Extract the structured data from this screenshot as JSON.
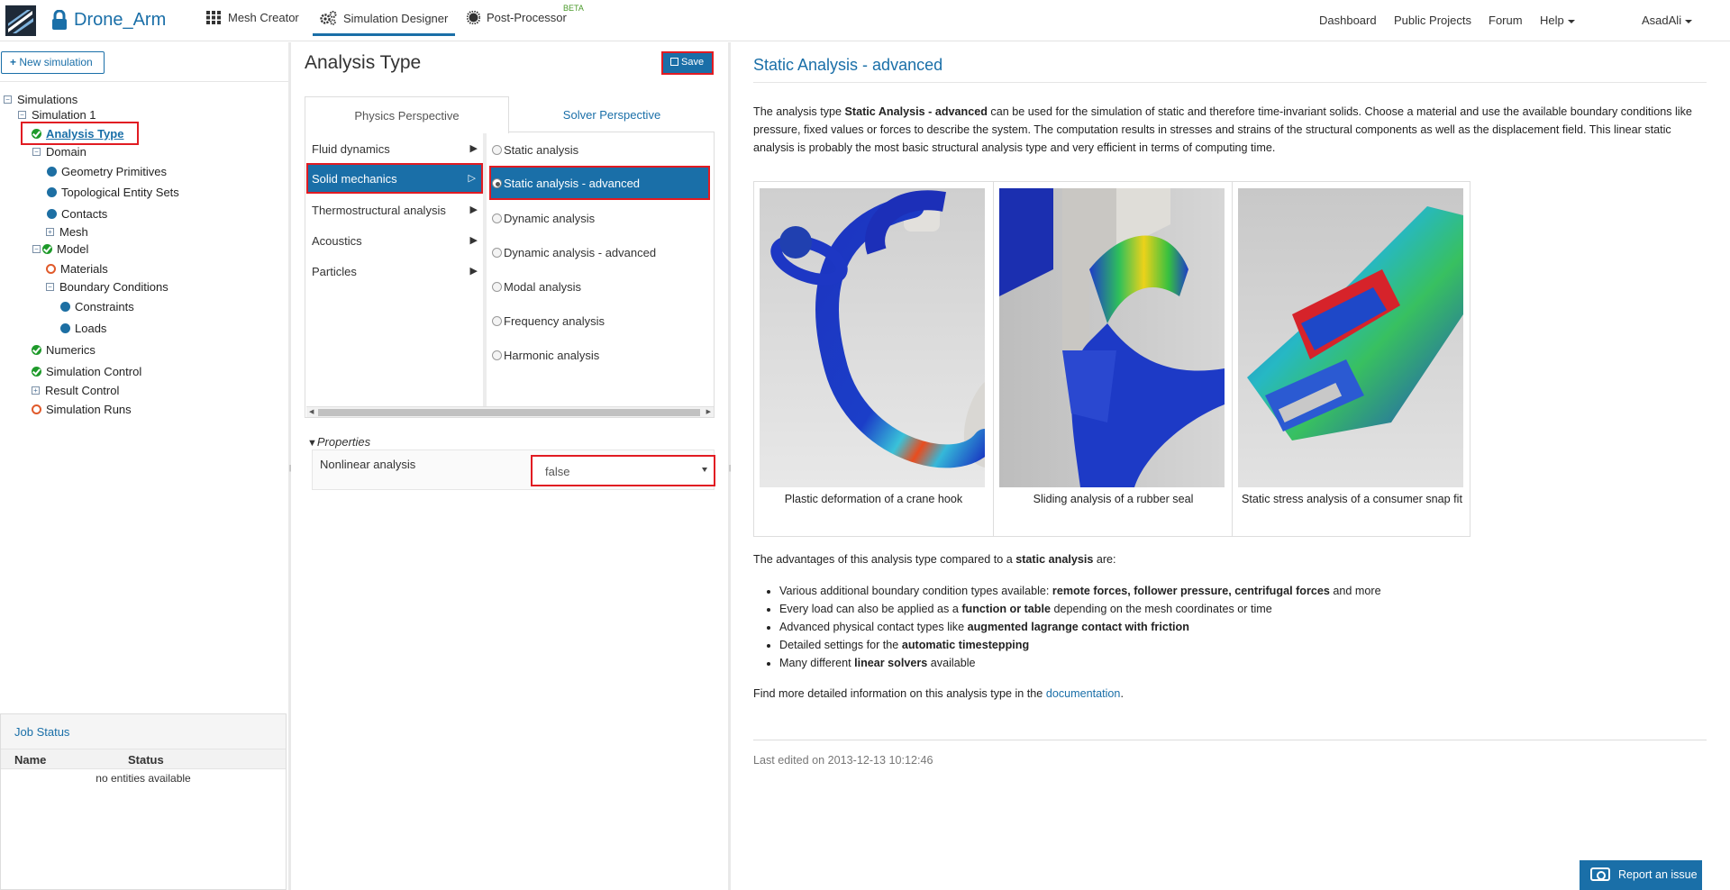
{
  "topbar": {
    "project_name": "Drone_Arm",
    "tabs": [
      {
        "label": "Mesh Creator",
        "icon": "grid-icon"
      },
      {
        "label": "Simulation Designer",
        "icon": "gears-icon",
        "active": true
      },
      {
        "label": "Post-Processor",
        "icon": "gear-burst-icon",
        "badge": "BETA"
      }
    ],
    "right_links": [
      "Dashboard",
      "Public Projects",
      "Forum",
      "Help"
    ],
    "user": "AsadAli"
  },
  "sidebar": {
    "new_simulation_label": "New simulation",
    "tree": {
      "root": "Simulations",
      "simulation": "Simulation 1",
      "analysis_type": "Analysis Type",
      "domain": "Domain",
      "domain_children": [
        "Geometry Primitives",
        "Topological Entity Sets",
        "Contacts",
        "Mesh"
      ],
      "model": "Model",
      "materials": "Materials",
      "boundary_conditions": "Boundary Conditions",
      "bc_children": [
        "Constraints",
        "Loads"
      ],
      "numerics": "Numerics",
      "simulation_control": "Simulation Control",
      "result_control": "Result Control",
      "simulation_runs": "Simulation Runs"
    },
    "job_status": {
      "title": "Job Status",
      "columns": [
        "Name",
        "Status"
      ],
      "empty": "no entities available"
    }
  },
  "middle": {
    "title": "Analysis Type",
    "save_label": "Save",
    "tabs": [
      "Physics Perspective",
      "Solver Perspective"
    ],
    "categories": [
      "Fluid dynamics",
      "Solid mechanics",
      "Thermostructural analysis",
      "Acoustics",
      "Particles"
    ],
    "selected_category": "Solid mechanics",
    "options": [
      "Static analysis",
      "Static analysis - advanced",
      "Dynamic analysis",
      "Dynamic analysis - advanced",
      "Modal analysis",
      "Frequency analysis",
      "Harmonic analysis"
    ],
    "selected_option": "Static analysis - advanced",
    "properties": {
      "heading": "Properties",
      "rows": [
        {
          "label": "Nonlinear analysis",
          "value": "false"
        }
      ]
    }
  },
  "content": {
    "title": "Static Analysis - advanced",
    "intro_pre": "The analysis type ",
    "intro_bold": "Static Analysis - advanced",
    "intro_post": " can be used for the simulation of static and therefore time-invariant solids. Choose a material and use the available boundary conditions like pressure, fixed values or forces to describe the system. The computation results in stresses and strains of the structural components as well as the displacement field. This linear static analysis is probably the most basic structural analysis type and very efficient in terms of computing time.",
    "gallery": [
      {
        "caption": "Plastic deformation of a crane hook"
      },
      {
        "caption": "Sliding analysis of a rubber seal"
      },
      {
        "caption": "Static stress analysis of a consumer snap fit"
      }
    ],
    "advantages_pre": "The advantages of this analysis type compared to a ",
    "advantages_bold": "static analysis",
    "advantages_post": " are:",
    "bullets": [
      {
        "pre": "Various additional boundary condition types available: ",
        "bold": "remote forces, follower pressure, centrifugal forces",
        "post": " and more"
      },
      {
        "pre": "Every load can also be applied as a ",
        "bold": "function or table",
        "post": " depending on the mesh coordinates or time"
      },
      {
        "pre": "Advanced physical contact types like ",
        "bold": "augmented lagrange contact with friction",
        "post": ""
      },
      {
        "pre": "Detailed settings for the ",
        "bold": "automatic timestepping",
        "post": ""
      },
      {
        "pre": "Many different ",
        "bold": "linear solvers",
        "post": " available"
      }
    ],
    "more_pre": "Find more detailed information on this analysis type in the ",
    "more_link": "documentation",
    "more_post": ".",
    "last_edited": "Last edited on 2013-12-13 10:12:46"
  },
  "report_issue_label": "Report an issue",
  "colors": {
    "accent": "#1a6fa8",
    "highlight": "#e11b22",
    "ok": "#1e9a2a",
    "error_ring": "#e05a2b"
  }
}
